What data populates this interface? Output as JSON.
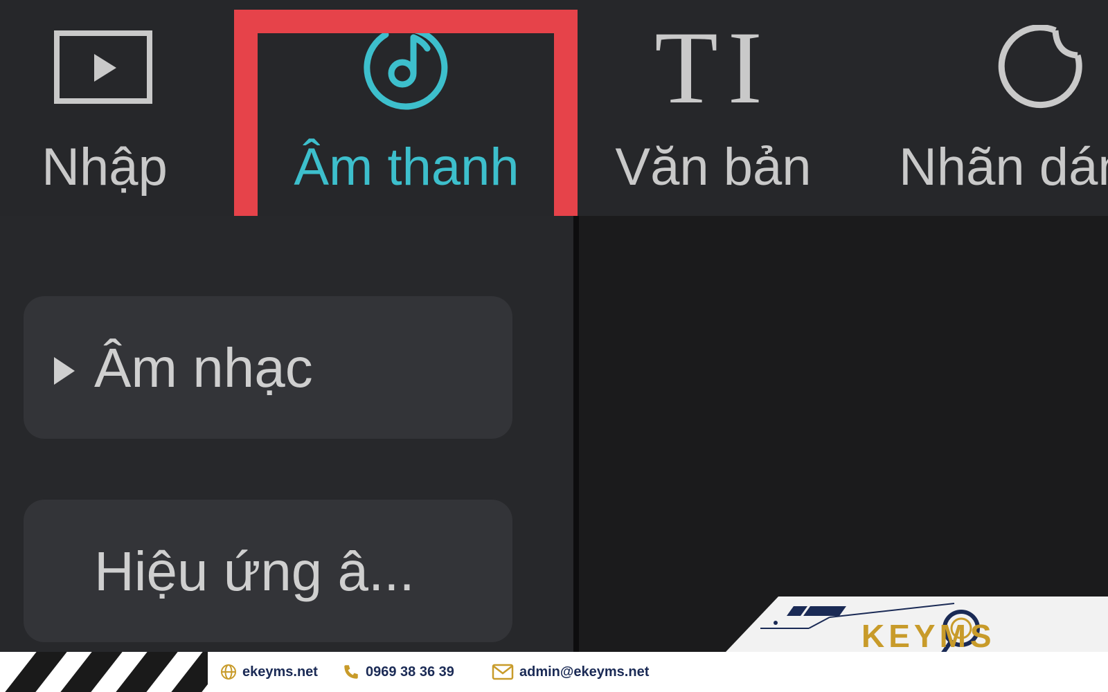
{
  "toolbar": {
    "items": [
      {
        "label": "Nhập",
        "icon": "play-box-icon"
      },
      {
        "label": "Âm thanh",
        "icon": "music-note-icon",
        "active": true
      },
      {
        "label": "Văn bản",
        "icon": "text-ti-icon",
        "glyph": "TI"
      },
      {
        "label": "Nhãn dán",
        "icon": "sticker-icon"
      }
    ]
  },
  "left_panel": {
    "categories": [
      {
        "label": "Âm nhạc",
        "expandable": true
      },
      {
        "label": "Hiệu ứng â..."
      }
    ]
  },
  "watermark": {
    "website": "ekeyms.net",
    "phone": "0969 38 36 39",
    "email": "admin@ekeyms.net",
    "logo": "KEYMS"
  },
  "colors": {
    "accent": "#3dbfcc",
    "highlight": "#e6434a",
    "toolbar_bg": "#26272a",
    "panel_bg": "#27282b",
    "canvas_bg": "#1b1b1c",
    "category_bg": "#333438",
    "brand_navy": "#1a2a55",
    "brand_gold": "#c89b2a"
  }
}
